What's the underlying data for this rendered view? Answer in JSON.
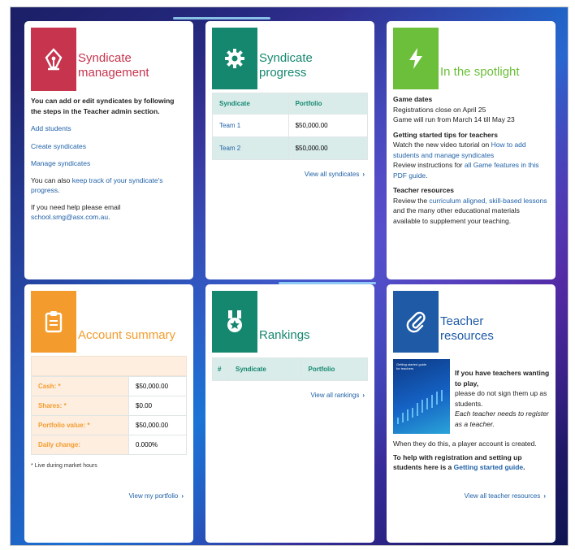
{
  "syndicate_management": {
    "title_line1": "Syndicate",
    "title_line2": "management",
    "intro": "You can add or edit syndicates by following the steps in the Teacher admin section.",
    "links": [
      "Add students",
      "Create syndicates",
      "Manage syndicates"
    ],
    "track_prefix": "You can also ",
    "track_link": "keep track of your syndicate's progress",
    "track_suffix": ".",
    "help_text": "If you need help please email",
    "email": "school.smg@asx.com.au",
    "email_suffix": ".",
    "color": "#c6344d"
  },
  "syndicate_progress": {
    "title_line1": "Syndicate",
    "title_line2": "progress",
    "headers": [
      "Syndicate",
      "Portfolio"
    ],
    "rows": [
      {
        "name": "Team 1",
        "portfolio": "$50,000.00"
      },
      {
        "name": "Team 2",
        "portfolio": "$50,000.00"
      }
    ],
    "view_all": "View all syndicates",
    "color": "#15876f"
  },
  "spotlight": {
    "title": "In the spotlight",
    "game_dates_heading": "Game dates",
    "registrations": "Registrations close on April 25",
    "game_run": "Game will run from March 14 till May 23",
    "tips_heading": "Getting started tips for teachers",
    "tips_prefix": "Watch the new video tutorial on ",
    "tips_link": "How to add students and manage syndicates",
    "review_prefix": "Review instructions for ",
    "review_link": "all Game features in this PDF guide",
    "review_suffix": ".",
    "resources_heading": "Teacher resources",
    "resources_prefix": "Review the ",
    "resources_link": "curriculum aligned, skill-based lessons",
    "resources_suffix": " and the many other educational materials available to supplement your teaching.",
    "color": "#6cbf3a"
  },
  "account_summary": {
    "title": "Account summary",
    "rows": [
      {
        "label": "Cash: *",
        "value": "$50,000.00"
      },
      {
        "label": "Shares: *",
        "value": "$0.00"
      },
      {
        "label": "Portfolio value: *",
        "value": "$50,000.00"
      },
      {
        "label": "Daily change:",
        "value": "0.000%"
      }
    ],
    "footnote": "* Live during market hours",
    "view_link": "View my portfolio",
    "color": "#f39c2d"
  },
  "rankings": {
    "title": "Rankings",
    "headers": [
      "#",
      "Syndicate",
      "Portfolio"
    ],
    "view_all": "View all rankings",
    "color": "#15876f"
  },
  "teacher_resources": {
    "title_line1": "Teacher",
    "title_line2": "resources",
    "bold_intro": "If you have teachers wanting to play,",
    "line2": "please do not sign them up as students.",
    "italic": "Each teacher needs to register as a teacher.",
    "line4": "When they do this, a player account is created.",
    "help_prefix": "To help with registration and setting up students here is a ",
    "help_link": "Getting started guide",
    "help_suffix": ".",
    "view_all": "View all teacher resources",
    "thumb_title": "Getting started guide for teachers",
    "color": "#1e5aa6"
  }
}
